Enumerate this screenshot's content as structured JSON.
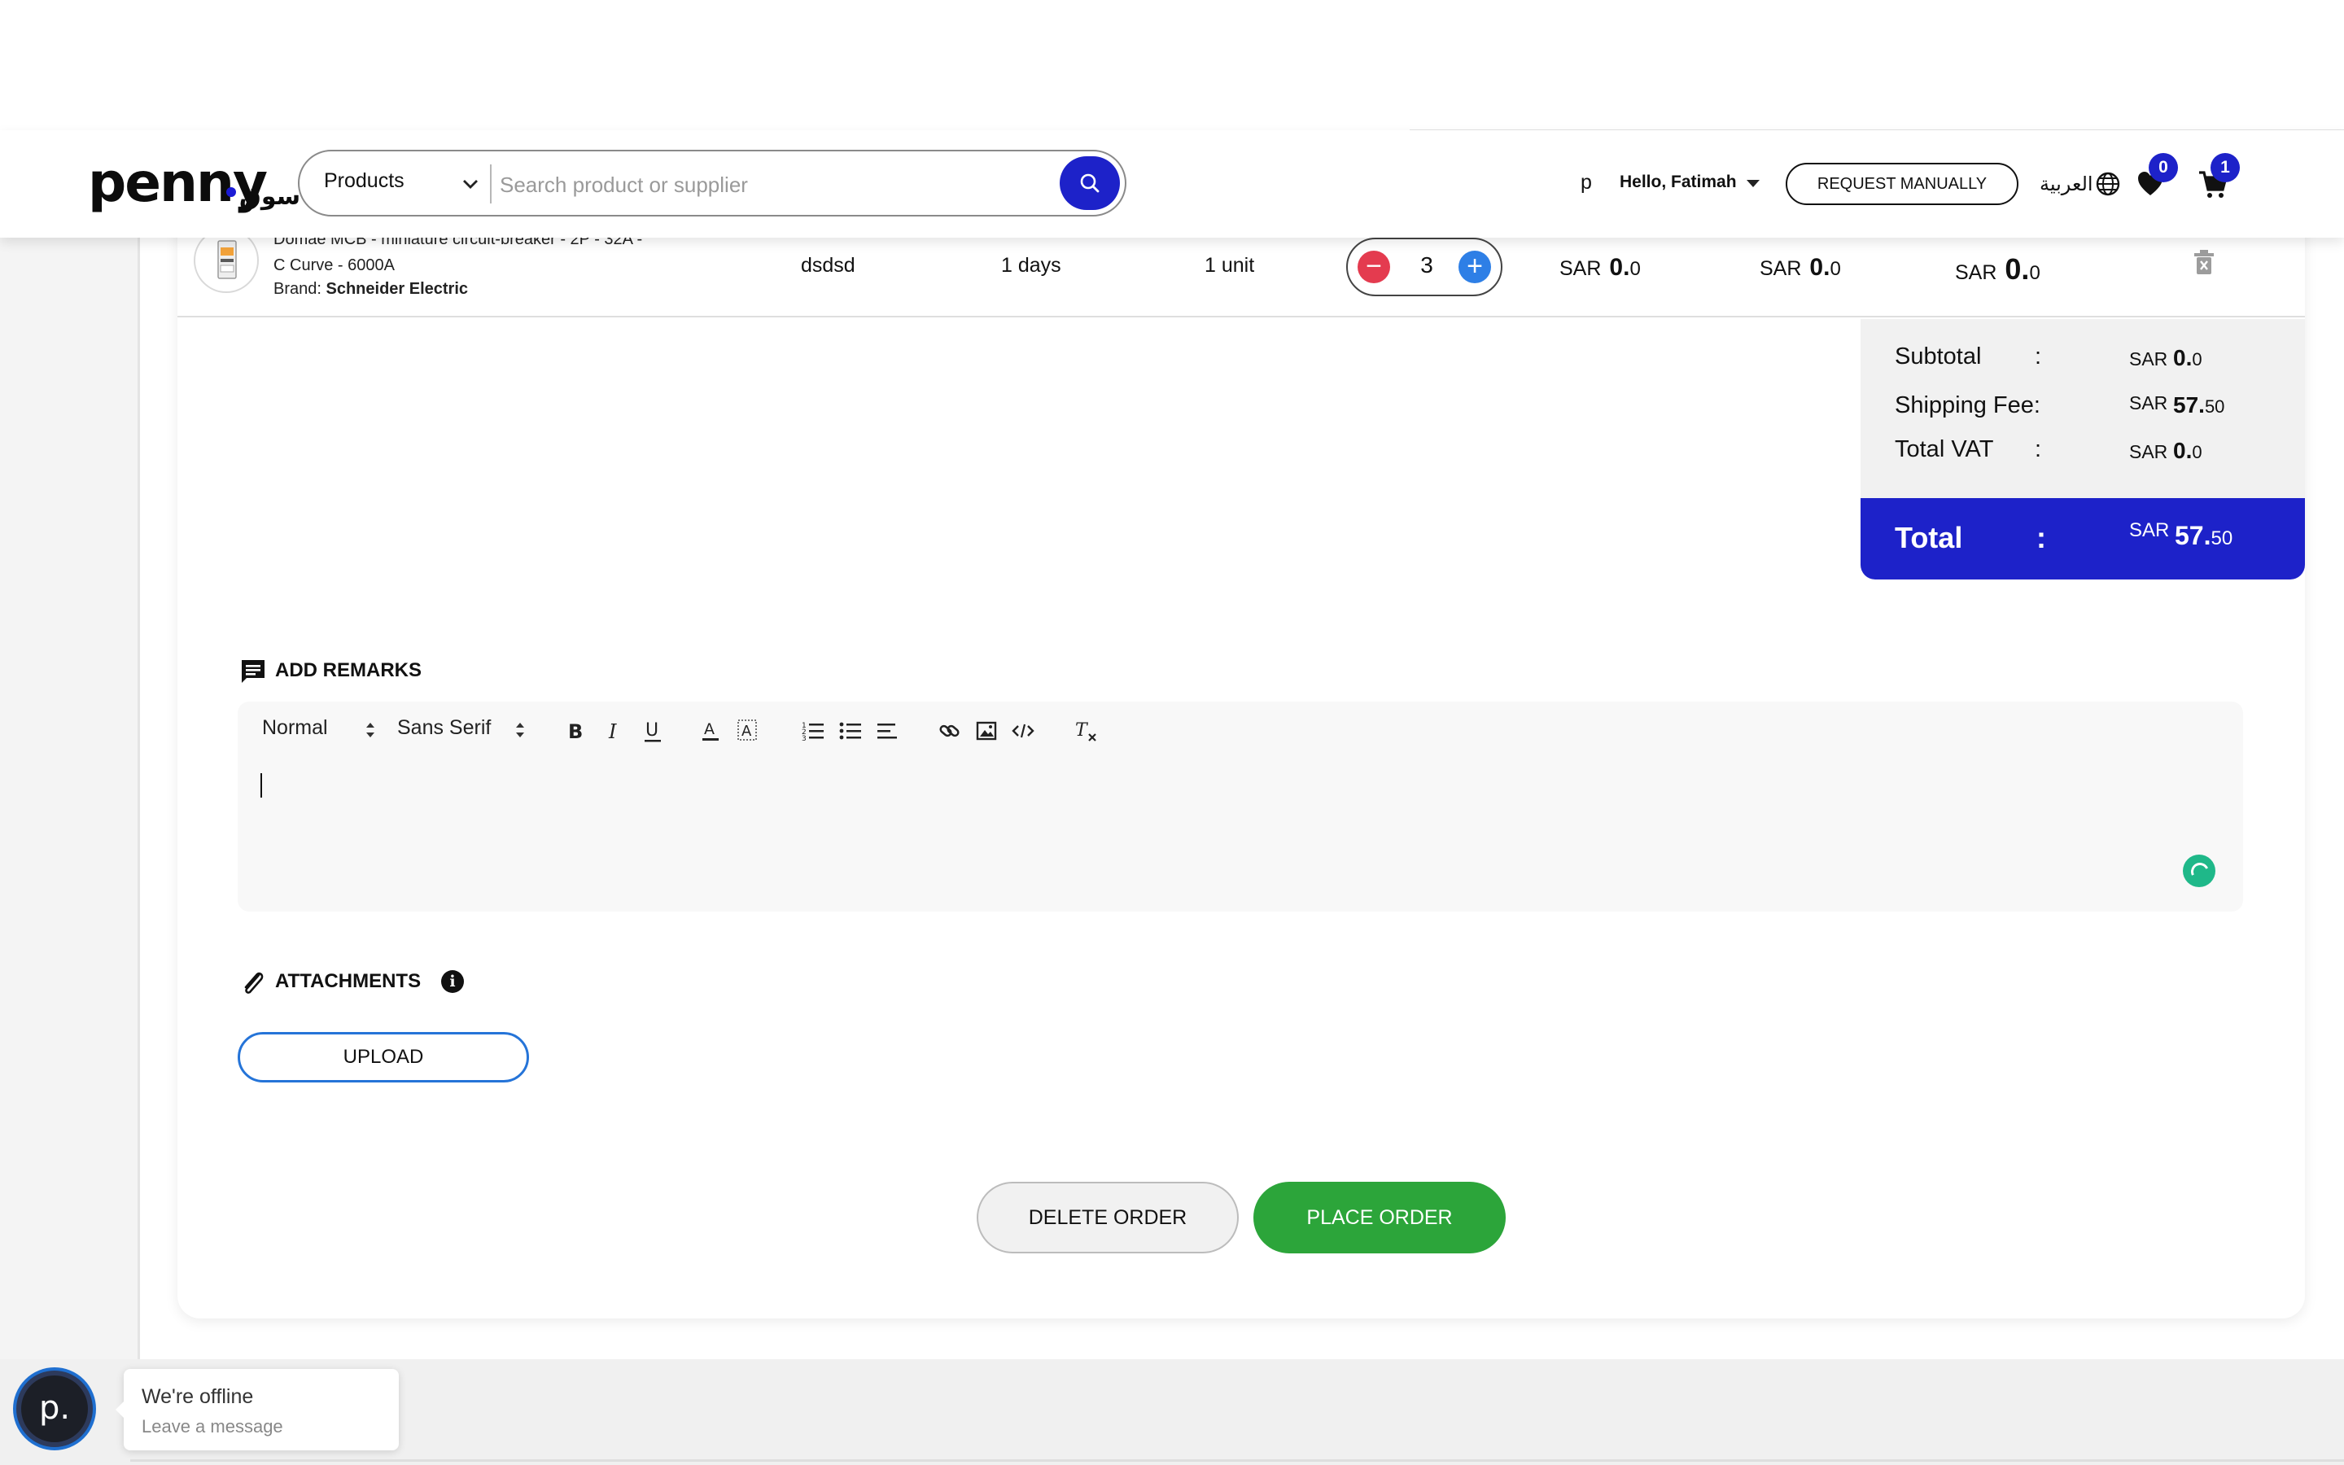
{
  "header": {
    "logo_text": "penny",
    "logo_arabic": "سوق",
    "search_category": "Products",
    "search_placeholder": "Search product or supplier",
    "user_initial": "p",
    "greeting": "Hello, Fatimah",
    "request_button": "REQUEST MANUALLY",
    "language": "العربية",
    "wishlist_count": "0",
    "cart_count": "1",
    "icons": [
      "chevron-down-icon",
      "search-icon",
      "caret-down-icon",
      "globe-icon",
      "heart-icon",
      "cart-icon"
    ]
  },
  "product_row": {
    "name": "Domae MCB - miniature circuit-breaker - 2P - 32A - C Curve - 6000A",
    "brand_label": "Brand:",
    "brand": "Schneider Electric",
    "supplier": "dsdsd",
    "lead_time": "1 days",
    "unit": "1 unit",
    "quantity": "3",
    "qty_minus": "−",
    "qty_plus": "+",
    "price": {
      "currency": "SAR",
      "amount": "0.",
      "decimal": "0"
    },
    "vat": {
      "currency": "SAR",
      "amount": "0.",
      "decimal": "0"
    },
    "total": {
      "currency": "SAR",
      "amount": "0.",
      "decimal": "0"
    }
  },
  "summary": {
    "subtotal_label": "Subtotal",
    "shipping_label": "Shipping Fee:",
    "vat_label": "Total VAT",
    "colon": ":",
    "currency": "SAR",
    "subtotal_amount": "0.",
    "subtotal_decimal": "0",
    "shipping_amount": "57.",
    "shipping_decimal": "50",
    "vat_amount": "0.",
    "vat_decimal": "0",
    "total_label": "Total",
    "total_amount": "57.",
    "total_decimal": "50"
  },
  "remarks": {
    "title": "ADD REMARKS",
    "format": "Normal",
    "font": "Sans Serif",
    "toolbar_icons": [
      "bold-icon",
      "italic-icon",
      "underline-icon",
      "text-color-icon",
      "background-color-icon",
      "ordered-list-icon",
      "bullet-list-icon",
      "align-icon",
      "link-icon",
      "image-icon",
      "code-icon",
      "clear-format-icon"
    ]
  },
  "attachments": {
    "title": "ATTACHMENTS",
    "info": "i",
    "upload_button": "UPLOAD"
  },
  "actions": {
    "delete": "DELETE ORDER",
    "place": "PLACE ORDER"
  },
  "chat": {
    "avatar_text": "p.",
    "title": "We're offline",
    "subtitle": "Leave a message"
  },
  "colors": {
    "brand_blue": "#1d22c9",
    "place_green": "#2ca53a",
    "minus_red": "#e43b4f",
    "plus_blue": "#2e7fe6"
  }
}
